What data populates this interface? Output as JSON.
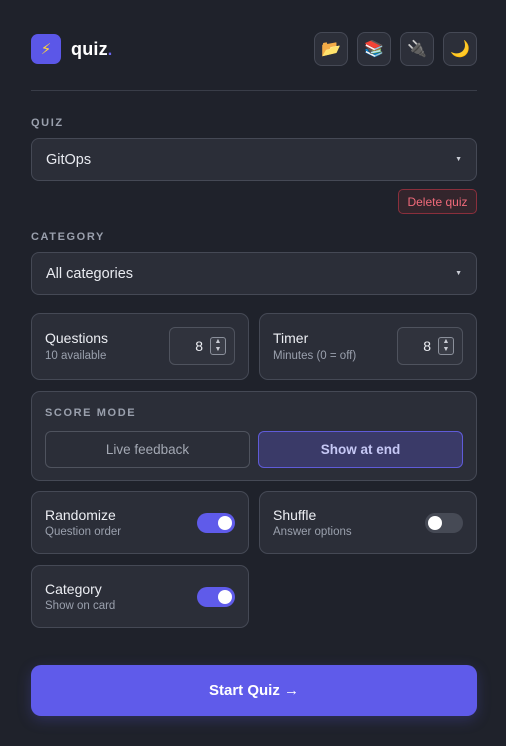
{
  "app": {
    "logo_icon": "⚡",
    "name": "quiz",
    "name_dot": "."
  },
  "header_actions": [
    {
      "name": "folder-icon",
      "glyph": "📂"
    },
    {
      "name": "books-icon",
      "glyph": "📚"
    },
    {
      "name": "plug-icon",
      "glyph": "🔌"
    },
    {
      "name": "moon-icon",
      "glyph": "🌙"
    }
  ],
  "quiz": {
    "label": "QUIZ",
    "selected": "GitOps",
    "delete_label": "Delete quiz"
  },
  "category": {
    "label": "CATEGORY",
    "selected": "All categories"
  },
  "questions": {
    "title": "Questions",
    "subtitle": "10 available",
    "value": "8"
  },
  "timer": {
    "title": "Timer",
    "subtitle": "Minutes (0 = off)",
    "value": "8"
  },
  "score_mode": {
    "label": "SCORE MODE",
    "option_live": "Live feedback",
    "option_end": "Show at end",
    "selected": "Show at end"
  },
  "randomize": {
    "title": "Randomize",
    "subtitle": "Question order",
    "enabled": true
  },
  "shuffle": {
    "title": "Shuffle",
    "subtitle": "Answer options",
    "enabled": false
  },
  "category_toggle": {
    "title": "Category",
    "subtitle": "Show on card",
    "enabled": true
  },
  "start": {
    "label": "Start Quiz →"
  },
  "colors": {
    "accent": "#5f5bea",
    "background": "#1f222b",
    "danger": "#f06a7a"
  }
}
